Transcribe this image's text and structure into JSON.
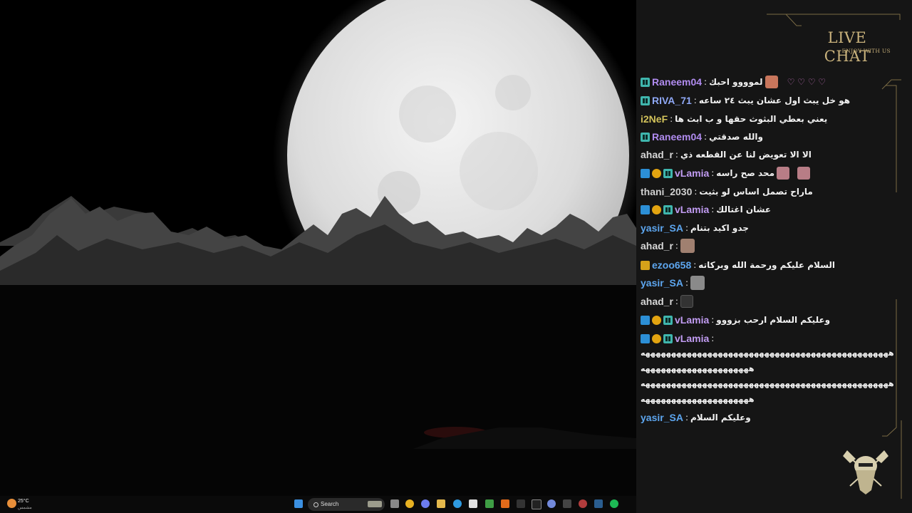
{
  "chat": {
    "title": "LIVE CHAT",
    "subtitle": "ENJOY WITH US",
    "separator": ":",
    "messages": [
      {
        "user": "Raneem04",
        "color": "#b18cf0",
        "badges": [
          "sub"
        ],
        "text": "لموووو احبك",
        "emote": true,
        "hearts": "♡ ♡ ♡ ♡"
      },
      {
        "user": "RIVA_71",
        "color": "#8fa8f5",
        "badges": [
          "sub"
        ],
        "text": "هو خل يبث اول عشان يبث ٢٤ ساعه"
      },
      {
        "user": "i2NeF",
        "color": "#d2c25a",
        "badges": [],
        "text": "يعني بعطي البثوث حقها و ب ابث ها"
      },
      {
        "user": "Raneem04",
        "color": "#b18cf0",
        "badges": [
          "sub"
        ],
        "text": "والله صدقتي"
      },
      {
        "user": "ahad_r",
        "color": "#d7d7d7",
        "badges": [],
        "text": "الا الا تعويض لنا عن القطعه ذي"
      },
      {
        "user": "vLamia",
        "color": "#c19cf2",
        "badges": [
          "arrow",
          "one",
          "sub"
        ],
        "text": "محد صح راسه",
        "emote": true
      },
      {
        "user": "thani_2030",
        "color": "#d0d0d0",
        "badges": [],
        "text": "ماراح تصمل اساس لو بثيت"
      },
      {
        "user": "vLamia",
        "color": "#c19cf2",
        "badges": [
          "arrow",
          "one",
          "sub"
        ],
        "text": "عشان اغتالك"
      },
      {
        "user": "yasir_SA",
        "color": "#5da6ef",
        "badges": [],
        "text": "جدو اكيد بتنام"
      },
      {
        "user": "ahad_r",
        "color": "#d7d7d7",
        "badges": [],
        "text": "",
        "emote": true
      },
      {
        "user": "ezoo658",
        "color": "#5da6ef",
        "badges": [
          "crown"
        ],
        "text": "السلام عليكم ورحمة الله وبركاته"
      },
      {
        "user": "yasir_SA",
        "color": "#5da6ef",
        "badges": [],
        "text": "",
        "emote": true
      },
      {
        "user": "ahad_r",
        "color": "#d7d7d7",
        "badges": [],
        "text": "",
        "emote": true
      },
      {
        "user": "vLamia",
        "color": "#c19cf2",
        "badges": [
          "arrow",
          "one",
          "sub"
        ],
        "text": "وعليكم السلام ارحب بزووو"
      },
      {
        "user": "vLamia",
        "color": "#c19cf2",
        "badges": [
          "arrow",
          "one",
          "sub"
        ],
        "text": ""
      },
      {
        "user": "yasir_SA",
        "color": "#5da6ef",
        "badges": [],
        "text": "وعليكم السلام"
      }
    ],
    "long_lines": [
      "ههههههههههههههههههههههههههههههههههههههههههههههههه",
      "هههههههههههههههههههههه",
      "ههههههههههههههههههههههههههههههههههههههههههههههههه",
      "هههههههههههههههههههههه"
    ]
  },
  "taskbar": {
    "search_placeholder": "Search",
    "weather_temp": "25°C",
    "weather_cond": "مشمس",
    "apps": [
      "windows",
      "search",
      "widgets",
      "task-view",
      "chrome",
      "copilot",
      "file-explorer",
      "edge",
      "store",
      "xbox",
      "vlc",
      "capcut",
      "x",
      "xbox-bar",
      "obs",
      "discord",
      "terminal",
      "steam",
      "spotify"
    ]
  },
  "colors": {
    "gold": "#c9b27c",
    "panel": "#151515",
    "moon": "#e9e9e9"
  }
}
